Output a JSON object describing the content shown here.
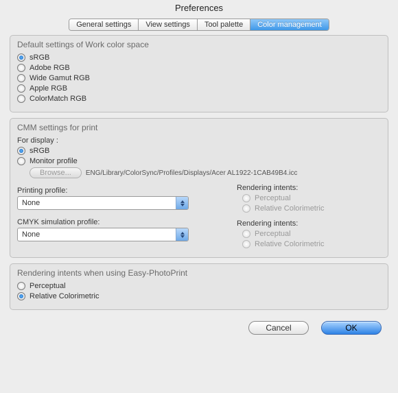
{
  "title": "Preferences",
  "tabs": [
    {
      "label": "General settings"
    },
    {
      "label": "View settings"
    },
    {
      "label": "Tool palette"
    },
    {
      "label": "Color management",
      "active": true
    }
  ],
  "workColor": {
    "title": "Default settings of Work color space",
    "options": [
      "sRGB",
      "Adobe RGB",
      "Wide Gamut RGB",
      "Apple RGB",
      "ColorMatch RGB"
    ],
    "selected": "sRGB"
  },
  "cmm": {
    "title": "CMM settings for print",
    "forDisplayLabel": "For display :",
    "displayOptions": [
      "sRGB",
      "Monitor profile"
    ],
    "displaySelected": "sRGB",
    "browseLabel": "Browse...",
    "monitorPath": "ENG/Library/ColorSync/Profiles/Displays/Acer AL1922-1CAB49B4.icc",
    "printingProfileLabel": "Printing profile:",
    "printingProfileValue": "None",
    "cmykLabel": "CMYK simulation profile:",
    "cmykValue": "None",
    "renderingLabel": "Rendering intents:",
    "renderingOptions": [
      "Perceptual",
      "Relative Colorimetric"
    ]
  },
  "easyPrint": {
    "title": "Rendering intents when using Easy-PhotoPrint",
    "options": [
      "Perceptual",
      "Relative Colorimetric"
    ],
    "selected": "Relative Colorimetric"
  },
  "buttons": {
    "cancel": "Cancel",
    "ok": "OK"
  }
}
